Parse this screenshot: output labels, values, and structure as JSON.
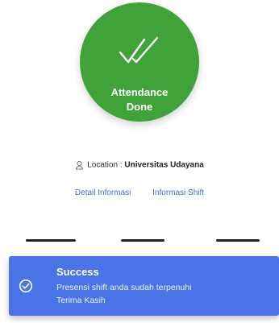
{
  "status_circle": {
    "line1": "Attendance",
    "line2": "Done",
    "color": "#3fa33a",
    "icon": "double-check-icon"
  },
  "location": {
    "label": "Location :",
    "value": "Universitas Udayana",
    "icon": "location-pin-icon"
  },
  "links": {
    "detail": "Detail Informasi",
    "shift": "Informasi Shift",
    "color": "#3e6fd8"
  },
  "toast": {
    "title": "Success",
    "message_line1": "Presensi shift anda sudah terpenuhi",
    "message_line2": "Terima Kasih",
    "icon": "check-circle-icon",
    "background": "#4a73e6"
  }
}
